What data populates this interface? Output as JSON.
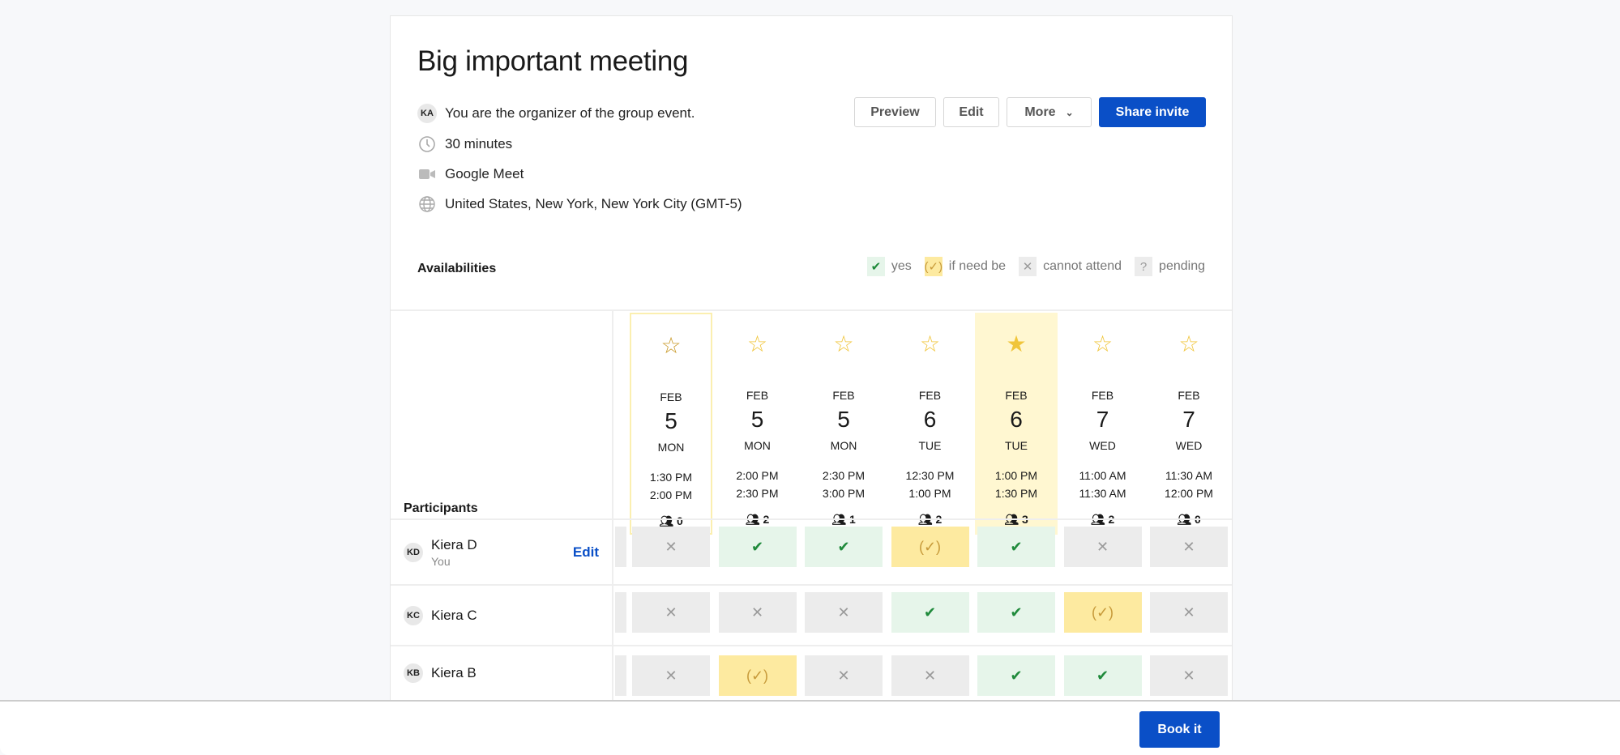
{
  "event": {
    "title": "Big important meeting",
    "organizer_initials": "KA",
    "organizer_text": "You are the organizer of the group event.",
    "duration": "30 minutes",
    "location": "Google Meet",
    "timezone": "United States, New York, New York City (GMT-5)"
  },
  "actions": {
    "preview": "Preview",
    "edit": "Edit",
    "more": "More",
    "share": "Share invite"
  },
  "availabilities": {
    "heading": "Availabilities",
    "legend": [
      {
        "label": "yes",
        "icon": "check-icon"
      },
      {
        "label": "if need be",
        "icon": "check-circle-icon"
      },
      {
        "label": "cannot attend",
        "icon": "x-icon"
      },
      {
        "label": "pending",
        "icon": "question-icon"
      }
    ]
  },
  "participants_heading": "Participants",
  "slots": [
    {
      "month": "FEB",
      "day": "5",
      "dow": "MON",
      "start": "1:30 PM",
      "end": "2:00 PM",
      "count": "0",
      "state": "selected"
    },
    {
      "month": "FEB",
      "day": "5",
      "dow": "MON",
      "start": "2:00 PM",
      "end": "2:30 PM",
      "count": "2"
    },
    {
      "month": "FEB",
      "day": "5",
      "dow": "MON",
      "start": "2:30 PM",
      "end": "3:00 PM",
      "count": "1"
    },
    {
      "month": "FEB",
      "day": "6",
      "dow": "TUE",
      "start": "12:30 PM",
      "end": "1:00 PM",
      "count": "2"
    },
    {
      "month": "FEB",
      "day": "6",
      "dow": "TUE",
      "start": "1:00 PM",
      "end": "1:30 PM",
      "count": "3",
      "state": "best"
    },
    {
      "month": "FEB",
      "day": "7",
      "dow": "WED",
      "start": "11:00 AM",
      "end": "11:30 AM",
      "count": "2"
    },
    {
      "month": "FEB",
      "day": "7",
      "dow": "WED",
      "start": "11:30 AM",
      "end": "12:00 PM",
      "count": "0"
    }
  ],
  "participants": [
    {
      "initials": "KD",
      "name": "Kiera D",
      "sub": "You",
      "edit": "Edit",
      "votes": [
        "no",
        "yes",
        "yes",
        "ifn",
        "yes",
        "no",
        "no"
      ]
    },
    {
      "initials": "KC",
      "name": "Kiera C",
      "votes": [
        "no",
        "no",
        "no",
        "yes",
        "yes",
        "ifn",
        "no"
      ]
    },
    {
      "initials": "KB",
      "name": "Kiera B",
      "votes": [
        "no",
        "ifn",
        "no",
        "no",
        "yes",
        "yes",
        "no"
      ]
    }
  ],
  "footer": {
    "book": "Book it"
  },
  "colors": {
    "accent": "#0a4fc7",
    "yes": "#e6f5ea",
    "if_need_be": "#fdeaa0",
    "cannot": "#ececec",
    "best": "#fff7d1"
  }
}
